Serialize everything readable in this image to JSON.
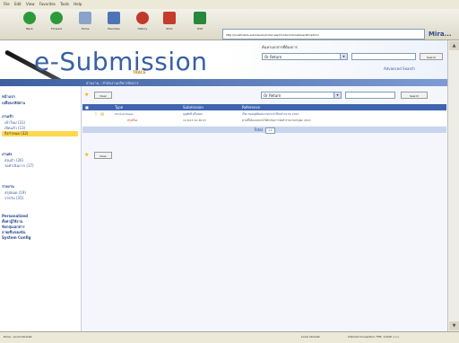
{
  "menu": [
    "File",
    "Edit",
    "View",
    "Favorites",
    "Tools",
    "Help"
  ],
  "toolbar": {
    "back": "Back",
    "forward": "Forward",
    "home": "Home",
    "favorites": "Favorites",
    "history": "History",
    "print": "Print",
    "edit": "Edit",
    "discuss": "Discuss",
    "address": "http://localhost/e-submission/index.asp?mode=inbox&UserID=admin",
    "go": "Launch URL",
    "brand": "Mira..."
  },
  "header": {
    "logo": "e-Submission",
    "logo_sub": "TRACE",
    "search_label": "ค้นหาเอกสารที่ต้องการ",
    "search_select": "Or Return",
    "search_button": "Search",
    "advanced": "Advanced Search",
    "band_text": "ส่วนงาน : สำนักงานบริหารจัดการ"
  },
  "sidebar": {
    "groups": [
      {
        "title": "หน้าแรก",
        "items": [
          "เปลี่ยนรหัสผ่าน"
        ]
      },
      {
        "title": "งานเข้า",
        "items": [
          "เข้าใหม่ (31)",
          "เปิดแล้ว (13)",
          "ถึงกำหนด (32)"
        ]
      },
      {
        "title": "งานส่ง",
        "items": [
          "ส่งแล้ว (26)",
          "รอดำเนินการ (17)"
        ]
      },
      {
        "title": "รายงาน",
        "items": [
          "สรุปยอด (19)",
          "รายวัน (35)"
        ]
      },
      {
        "title": "Personalized",
        "items": [
          "ตั้งค่าผู้ใช้งาน",
          "จัดกลุ่มเอกสาร",
          "ลายเซ็นของฉัน",
          "System Config"
        ]
      }
    ]
  },
  "main": {
    "clear": "Clear",
    "select_value": "Or Return",
    "search_btn": "Search",
    "columns": [
      "Ok",
      "Type",
      "Submission",
      "Reference"
    ],
    "rows": [
      {
        "flag": "!",
        "type": "Product Paper",
        "type2": "สรุปเรื่อง",
        "person": "บุญศักดิ์ ศรีมงคล",
        "date": "11/9/15 10:36:47",
        "ref1": "เรื่อง ขออนุมัติแผนงานประจำปีงบประมาณ 2015",
        "ref2": "ตามที่ได้มอบหมายให้ดำเนินการจัดทำรายงานสรุปผล 2015"
      }
    ],
    "pager_label": "Total",
    "pager_value": "1",
    "clear2": "Clear"
  },
  "status": {
    "left": "Done - Local intranet",
    "zone": "Local intranet",
    "right": "Internet Connection: TPS: 1,0/20 >>>"
  }
}
